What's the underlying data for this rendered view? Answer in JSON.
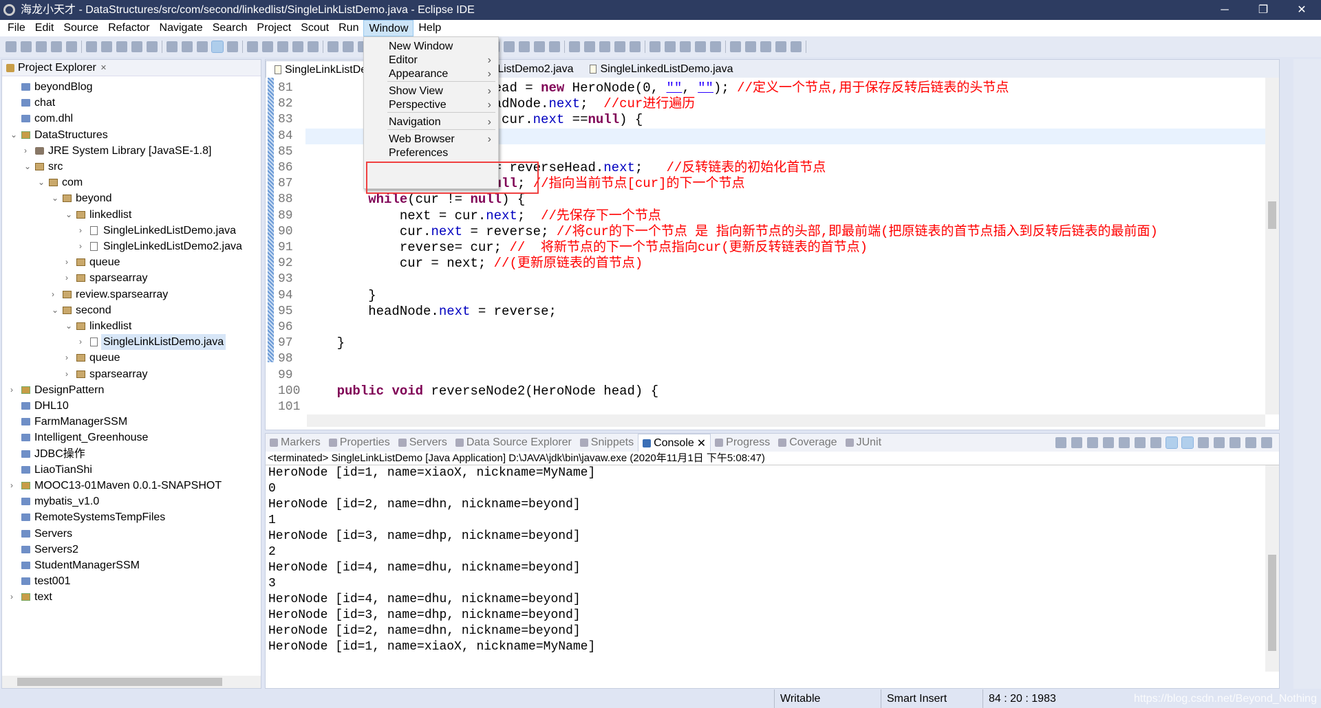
{
  "window": {
    "title": "海龙小天才 - DataStructures/src/com/second/linkedlist/SingleLinkListDemo.java - Eclipse IDE",
    "minimize": "─",
    "restore": "❐",
    "close": "✕"
  },
  "menu": [
    "File",
    "Edit",
    "Source",
    "Refactor",
    "Navigate",
    "Search",
    "Project",
    "Scout",
    "Run",
    "Window",
    "Help"
  ],
  "active_menu": "Window",
  "window_menu": {
    "items": [
      {
        "label": "New Window",
        "sub": false
      },
      {
        "label": "Editor",
        "sub": true
      },
      {
        "label": "Appearance",
        "sub": true
      },
      {
        "label": "Show View",
        "sub": true
      },
      {
        "label": "Perspective",
        "sub": true
      },
      {
        "label": "Navigation",
        "sub": true
      },
      {
        "label": "Web Browser",
        "sub": true
      },
      {
        "label": "Preferences",
        "sub": false
      }
    ],
    "highlighted": "Preferences",
    "highlight_color": "#f04040"
  },
  "explorer": {
    "title": "Project Explorer",
    "close": "✕",
    "tree": [
      {
        "level": 0,
        "icon": "folder",
        "label": "beyondBlog",
        "arrow": ""
      },
      {
        "level": 0,
        "icon": "folder",
        "label": "chat",
        "arrow": ""
      },
      {
        "level": 0,
        "icon": "folder",
        "label": "com.dhl",
        "arrow": ""
      },
      {
        "level": 0,
        "icon": "project",
        "label": "DataStructures",
        "arrow": "open"
      },
      {
        "level": 1,
        "icon": "lib",
        "label": "JRE System Library [JavaSE-1.8]",
        "arrow": "closed"
      },
      {
        "level": 1,
        "icon": "pkg",
        "label": "src",
        "arrow": "open"
      },
      {
        "level": 2,
        "icon": "pkg",
        "label": "com",
        "arrow": "open"
      },
      {
        "level": 3,
        "icon": "pkg",
        "label": "beyond",
        "arrow": "open"
      },
      {
        "level": 4,
        "icon": "pkg",
        "label": "linkedlist",
        "arrow": "open"
      },
      {
        "level": 5,
        "icon": "java",
        "label": "SingleLinkedListDemo.java",
        "arrow": "closed"
      },
      {
        "level": 5,
        "icon": "java",
        "label": "SingleLinkedListDemo2.java",
        "arrow": "closed"
      },
      {
        "level": 4,
        "icon": "pkg",
        "label": "queue",
        "arrow": "closed"
      },
      {
        "level": 4,
        "icon": "pkg",
        "label": "sparsearray",
        "arrow": "closed"
      },
      {
        "level": 3,
        "icon": "pkg",
        "label": "review.sparsearray",
        "arrow": "closed"
      },
      {
        "level": 3,
        "icon": "pkg",
        "label": "second",
        "arrow": "open"
      },
      {
        "level": 4,
        "icon": "pkg",
        "label": "linkedlist",
        "arrow": "open"
      },
      {
        "level": 5,
        "icon": "java",
        "label": "SingleLinkListDemo.java",
        "arrow": "closed",
        "selected": true
      },
      {
        "level": 4,
        "icon": "pkg",
        "label": "queue",
        "arrow": "closed"
      },
      {
        "level": 4,
        "icon": "pkg",
        "label": "sparsearray",
        "arrow": "closed"
      },
      {
        "level": 0,
        "icon": "project",
        "label": "DesignPattern",
        "arrow": "closed"
      },
      {
        "level": 0,
        "icon": "folder",
        "label": "DHL10",
        "arrow": ""
      },
      {
        "level": 0,
        "icon": "folder",
        "label": "FarmManagerSSM",
        "arrow": ""
      },
      {
        "level": 0,
        "icon": "folder",
        "label": "Intelligent_Greenhouse",
        "arrow": ""
      },
      {
        "level": 0,
        "icon": "folder",
        "label": "JDBC操作",
        "arrow": ""
      },
      {
        "level": 0,
        "icon": "folder",
        "label": "LiaoTianShi",
        "arrow": ""
      },
      {
        "level": 0,
        "icon": "project",
        "label": "MOOC13-01Maven  0.0.1-SNAPSHOT",
        "arrow": "closed"
      },
      {
        "level": 0,
        "icon": "folder",
        "label": "mybatis_v1.0",
        "arrow": ""
      },
      {
        "level": 0,
        "icon": "folder",
        "label": "RemoteSystemsTempFiles",
        "arrow": ""
      },
      {
        "level": 0,
        "icon": "folder",
        "label": "Servers",
        "arrow": ""
      },
      {
        "level": 0,
        "icon": "folder",
        "label": "Servers2",
        "arrow": ""
      },
      {
        "level": 0,
        "icon": "folder",
        "label": "StudentManagerSSM",
        "arrow": ""
      },
      {
        "level": 0,
        "icon": "folder",
        "label": "test001",
        "arrow": ""
      },
      {
        "level": 0,
        "icon": "project",
        "label": "text",
        "arrow": "closed"
      }
    ]
  },
  "editor": {
    "tabs": [
      "SingleLinkListDe",
      "ListDemo2.java",
      "SingleLinkedListDemo.java"
    ],
    "current_line": 84,
    "lines": [
      {
        "n": "81",
        "seg": [
          [
            "                        ead = ",
            ""
          ],
          [
            "new",
            "kw"
          ],
          [
            " HeroNode(0, ",
            ""
          ],
          [
            "\"\"",
            "st"
          ],
          [
            ", ",
            ""
          ],
          [
            "\"\"",
            "st"
          ],
          [
            "); ",
            ""
          ],
          [
            "//定义一个节点,用于保存反转后链表的头节点",
            "cm"
          ]
        ]
      },
      {
        "n": "82",
        "seg": [
          [
            "                        adNode.",
            ""
          ],
          [
            "next",
            "fd"
          ],
          [
            ";  ",
            ""
          ],
          [
            "//cur进行遍历",
            "cm"
          ]
        ]
      },
      {
        "n": "83",
        "seg": [
          [
            "                         cur.",
            ""
          ],
          [
            "next",
            "fd"
          ],
          [
            " ==",
            ""
          ],
          [
            "null",
            "kw"
          ],
          [
            ") {",
            ""
          ]
        ]
      },
      {
        "n": "84",
        "seg": []
      },
      {
        "n": "85",
        "seg": []
      },
      {
        "n": "86",
        "seg": [
          [
            "                        = reverseHead.",
            ""
          ],
          [
            "next",
            "fd"
          ],
          [
            ";   ",
            ""
          ],
          [
            "//反转链表的初始化首节点",
            "cm"
          ]
        ]
      },
      {
        "n": "87",
        "seg": [
          [
            "                        ",
            ""
          ],
          [
            "ull",
            "kw"
          ],
          [
            "; ",
            ""
          ],
          [
            "//指向当前节点[cur]的下一个节点",
            "cm"
          ]
        ]
      },
      {
        "n": "88",
        "seg": [
          [
            "        ",
            ""
          ],
          [
            "while",
            "kw"
          ],
          [
            "(cur != ",
            ""
          ],
          [
            "null",
            "kw"
          ],
          [
            ") {",
            ""
          ]
        ]
      },
      {
        "n": "89",
        "seg": [
          [
            "            next = cur.",
            ""
          ],
          [
            "next",
            "fd"
          ],
          [
            ";  ",
            ""
          ],
          [
            "//先保存下一个节点",
            "cm"
          ]
        ]
      },
      {
        "n": "90",
        "seg": [
          [
            "            cur.",
            ""
          ],
          [
            "next",
            "fd"
          ],
          [
            " = reverse; ",
            ""
          ],
          [
            "//将cur的下一个节点 是 指向新节点的头部,即最前端(把原链表的首节点插入到反转后链表的最前面)",
            "cm"
          ]
        ]
      },
      {
        "n": "91",
        "seg": [
          [
            "            reverse= cur; ",
            ""
          ],
          [
            "//  将新节点的下一个节点指向cur(更新反转链表的首节点)",
            "cm"
          ]
        ]
      },
      {
        "n": "92",
        "seg": [
          [
            "            cur = next; ",
            ""
          ],
          [
            "//(更新原链表的首节点)",
            "cm"
          ]
        ]
      },
      {
        "n": "93",
        "seg": []
      },
      {
        "n": "94",
        "seg": [
          [
            "        }",
            ""
          ]
        ]
      },
      {
        "n": "95",
        "seg": [
          [
            "        headNode.",
            ""
          ],
          [
            "next",
            "fd"
          ],
          [
            " = reverse;",
            ""
          ]
        ]
      },
      {
        "n": "96",
        "seg": []
      },
      {
        "n": "97",
        "seg": [
          [
            "    }",
            ""
          ]
        ]
      },
      {
        "n": "98",
        "seg": []
      },
      {
        "n": "99",
        "seg": []
      },
      {
        "n": "100",
        "seg": [
          [
            "    ",
            ""
          ],
          [
            "public",
            "kw"
          ],
          [
            " ",
            ""
          ],
          [
            "void",
            "kw"
          ],
          [
            " reverseNode2(HeroNode head) {",
            ""
          ]
        ]
      },
      {
        "n": "101",
        "seg": []
      }
    ]
  },
  "console": {
    "tabs": [
      "Markers",
      "Properties",
      "Servers",
      "Data Source Explorer",
      "Snippets",
      "Console",
      "Progress",
      "Coverage",
      "JUnit"
    ],
    "active": "Console",
    "terminated": "<terminated> SingleLinkListDemo [Java Application] D:\\JAVA\\jdk\\bin\\javaw.exe (2020年11月1日 下午5:08:47)",
    "output": [
      "HeroNode [id=1, name=xiaoX, nickname=MyName]",
      "0",
      "HeroNode [id=2, name=dhn, nickname=beyond]",
      "1",
      "HeroNode [id=3, name=dhp, nickname=beyond]",
      "2",
      "HeroNode [id=4, name=dhu, nickname=beyond]",
      "3",
      "HeroNode [id=4, name=dhu, nickname=beyond]",
      "HeroNode [id=3, name=dhp, nickname=beyond]",
      "HeroNode [id=2, name=dhn, nickname=beyond]",
      "HeroNode [id=1, name=xiaoX, nickname=MyName]"
    ]
  },
  "status": {
    "writable": "Writable",
    "insert_mode": "Smart Insert",
    "position": "84 : 20 : 1983",
    "watermark": "https://blog.csdn.net/Beyond_Nothing"
  }
}
